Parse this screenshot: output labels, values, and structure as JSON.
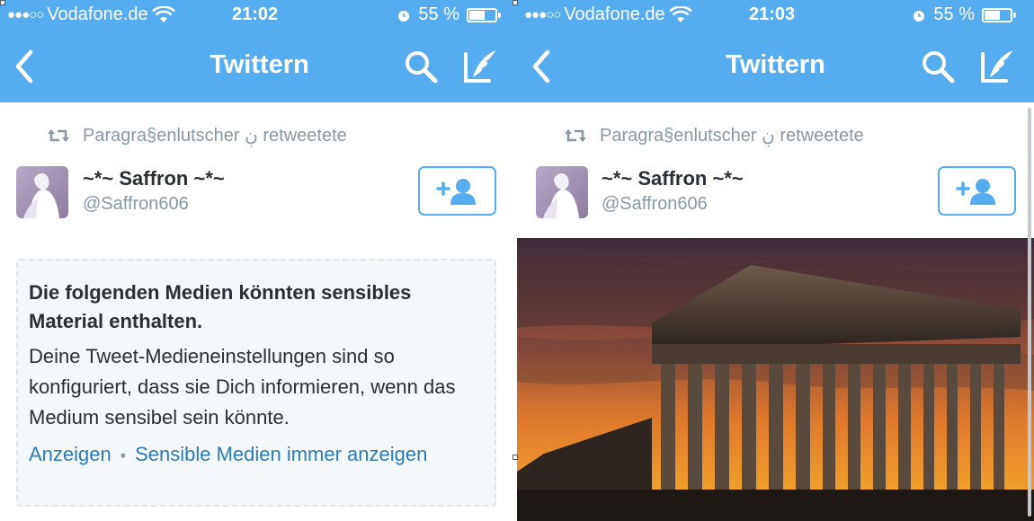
{
  "status": {
    "carrier": "Vodafone.de",
    "signal_dots": "●●●○○",
    "left_time": "21:02",
    "right_time": "21:03",
    "battery": "55 %",
    "battery_level": 0.55
  },
  "nav": {
    "title": "Twittern",
    "back_icon": "chevron-left-icon",
    "search_icon": "search-icon",
    "compose_icon": "compose-quill-icon"
  },
  "tweet": {
    "retweet_text": "Paragra§enlutscher ڹ retweetete",
    "display_name": "~*~ Saffron ~*~",
    "handle": "@Saffron606"
  },
  "sensitive": {
    "title": "Die folgenden Medien könnten sensibles Material enthalten.",
    "body": "Deine Tweet-Medieneinstellungen sind so konfiguriert, dass sie Dich informieren, wenn das Medium sensibel sein könnte.",
    "show_link": "Anzeigen",
    "separator": "•",
    "always_link": "Sensible Medien immer anzeigen"
  },
  "colors": {
    "accent": "#55acee",
    "link": "#2b7bb9",
    "muted": "#8899a6",
    "text": "#292f33"
  }
}
